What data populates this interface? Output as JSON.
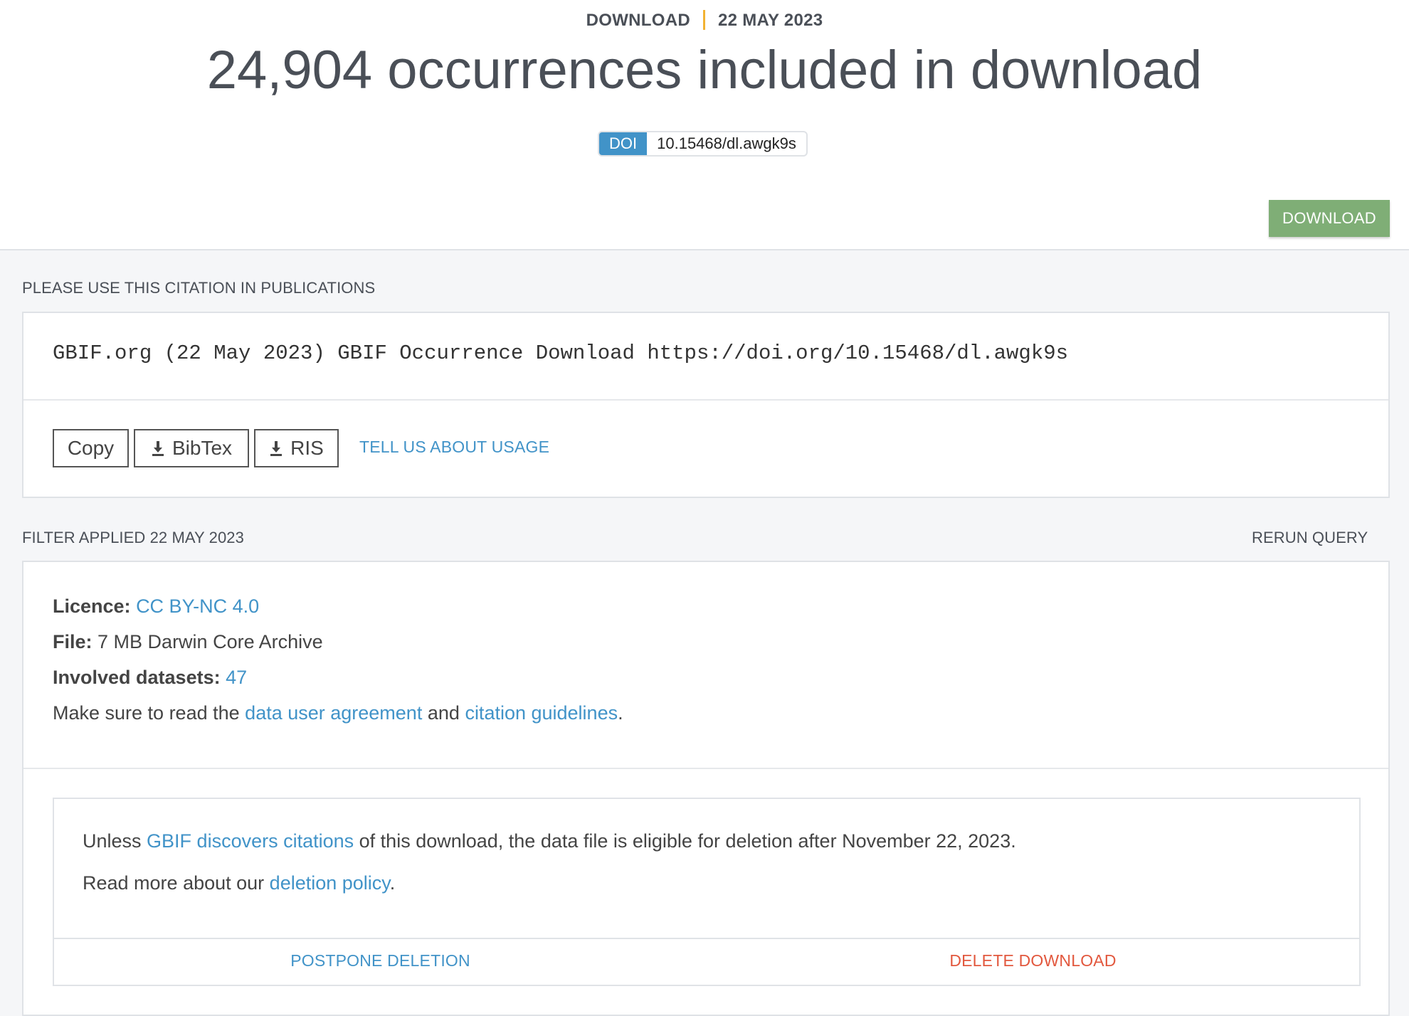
{
  "header": {
    "kind": "DOWNLOAD",
    "date": "22 MAY 2023",
    "title": "24,904 occurrences included in download",
    "doi_label": "DOI",
    "doi_value": "10.15468/dl.awgk9s",
    "download_button": "DOWNLOAD"
  },
  "citation": {
    "section_label": "PLEASE USE THIS CITATION IN PUBLICATIONS",
    "text": "GBIF.org (22 May 2023) GBIF Occurrence Download https://doi.org/10.15468/dl.awgk9s",
    "buttons": {
      "copy": "Copy",
      "bibtex": "BibTex",
      "ris": "RIS"
    },
    "tell_us": "TELL US ABOUT USAGE"
  },
  "filter": {
    "section_label": "FILTER APPLIED 22 MAY 2023",
    "rerun": "RERUN QUERY",
    "licence_label": "Licence:",
    "licence_value": "CC BY-NC 4.0",
    "file_label": "File:",
    "file_value": "7 MB Darwin Core Archive",
    "datasets_label": "Involved datasets:",
    "datasets_value": "47",
    "read_prefix": "Make sure to read the",
    "read_link1": "data user agreement",
    "read_and": "and",
    "read_link2": "citation guidelines",
    "read_suffix": "."
  },
  "deletion": {
    "line1_prefix": "Unless",
    "line1_link": "GBIF discovers citations",
    "line1_suffix": "of this download, the data file is eligible for deletion after November 22, 2023.",
    "line2_prefix": "Read more about our",
    "line2_link": "deletion policy",
    "line2_suffix": ".",
    "postpone": "POSTPONE DELETION",
    "delete": "DELETE DOWNLOAD"
  },
  "icons": {
    "download": "download-arrow-icon"
  },
  "colors": {
    "accent": "#4193c8",
    "download_button": "#7fae76",
    "danger": "#e2583e",
    "separator": "#f2b233"
  }
}
